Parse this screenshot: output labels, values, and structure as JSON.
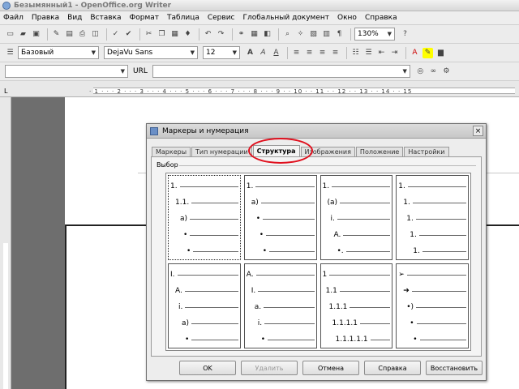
{
  "window": {
    "title": "Безымянный1 - OpenOffice.org Writer"
  },
  "menu": [
    "Файл",
    "Правка",
    "Вид",
    "Вставка",
    "Формат",
    "Таблица",
    "Сервис",
    "Глобальный документ",
    "Окно",
    "Справка"
  ],
  "toolbar": {
    "zoom": "130%"
  },
  "format_bar": {
    "style": "Базовый",
    "font": "DejaVu Sans",
    "size": "12"
  },
  "url_bar": {
    "label": "URL"
  },
  "ruler": {
    "numbers": "· 1 · · · 2 · · · 3 · · · 4 · · · 5 · · · 6 · · · 7 · · · 8 · · · 9 · · 10 · · 11 · · 12 · · 13 · · 14 · · 15"
  },
  "dialog": {
    "title": "Маркеры и нумерация",
    "close": "×",
    "tabs": [
      "Маркеры",
      "Тип нумерации",
      "Структура",
      "Изображения",
      "Положение",
      "Настройки"
    ],
    "active_tab": 2,
    "group_label": "Выбор",
    "presets": [
      [
        {
          "label": "1.",
          "indent": 0
        },
        {
          "label": "1.1.",
          "indent": 6
        },
        {
          "label": "a)",
          "indent": 12
        },
        {
          "label": "•",
          "indent": 16
        },
        {
          "label": "•",
          "indent": 20
        }
      ],
      [
        {
          "label": "1.",
          "indent": 0
        },
        {
          "label": "a)",
          "indent": 6
        },
        {
          "label": "•",
          "indent": 12
        },
        {
          "label": "•",
          "indent": 16
        },
        {
          "label": "•",
          "indent": 20
        }
      ],
      [
        {
          "label": "1.",
          "indent": 0
        },
        {
          "label": "(a)",
          "indent": 6
        },
        {
          "label": "i.",
          "indent": 10
        },
        {
          "label": "A.",
          "indent": 14
        },
        {
          "label": "•.",
          "indent": 18
        }
      ],
      [
        {
          "label": "1.",
          "indent": 0
        },
        {
          "label": "1.",
          "indent": 6
        },
        {
          "label": "1.",
          "indent": 10
        },
        {
          "label": "1.",
          "indent": 14
        },
        {
          "label": "1.",
          "indent": 18
        }
      ],
      [
        {
          "label": "I.",
          "indent": 0
        },
        {
          "label": "A.",
          "indent": 6
        },
        {
          "label": "i.",
          "indent": 10
        },
        {
          "label": "a)",
          "indent": 14
        },
        {
          "label": "•",
          "indent": 18
        }
      ],
      [
        {
          "label": "A.",
          "indent": 0
        },
        {
          "label": "I.",
          "indent": 6
        },
        {
          "label": "a.",
          "indent": 10
        },
        {
          "label": "i.",
          "indent": 14
        },
        {
          "label": "•",
          "indent": 18
        }
      ],
      [
        {
          "label": "1",
          "indent": 0
        },
        {
          "label": "1.1",
          "indent": 4
        },
        {
          "label": "1.1.1",
          "indent": 8
        },
        {
          "label": "1.1.1.1",
          "indent": 12
        },
        {
          "label": "1.1.1.1.1",
          "indent": 16
        }
      ],
      [
        {
          "label": "➢",
          "indent": 0
        },
        {
          "label": "➔",
          "indent": 6
        },
        {
          "label": "•)",
          "indent": 10
        },
        {
          "label": "•",
          "indent": 14
        },
        {
          "label": "•",
          "indent": 18
        }
      ]
    ],
    "buttons": {
      "ok": "OK",
      "delete": "Удалить",
      "cancel": "Отмена",
      "help": "Справка",
      "reset": "Восстановить"
    }
  }
}
